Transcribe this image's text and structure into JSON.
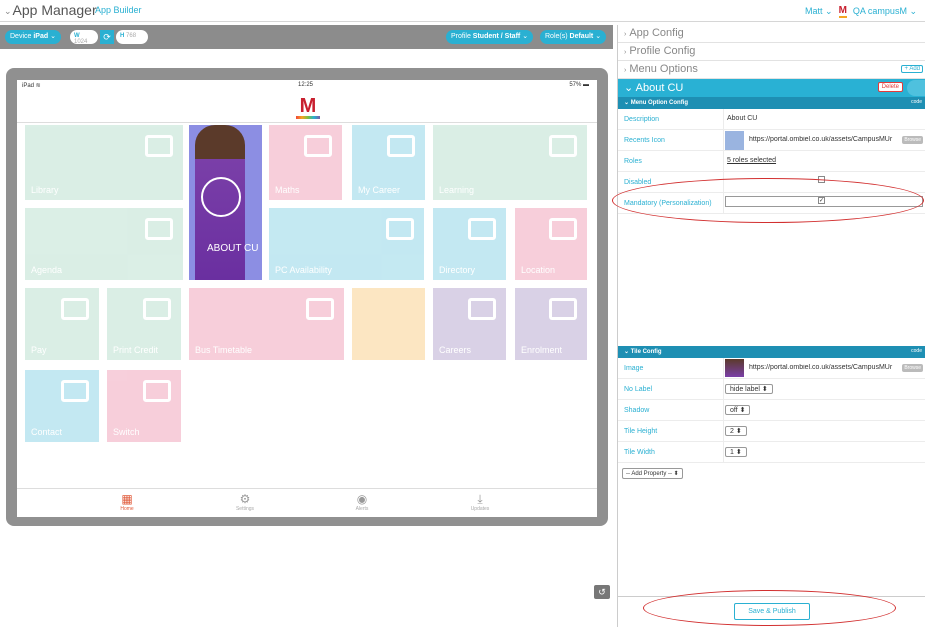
{
  "header": {
    "title": "App Manager",
    "subtitle": "App Builder",
    "user": "Matt",
    "org": "QA campusM"
  },
  "toolbar": {
    "device_label": "Device",
    "device_value": "iPad",
    "w_label": "W",
    "w_value": "1024",
    "h_label": "H",
    "h_value": "768",
    "profile_label": "Profile",
    "profile_value": "Student / Staff",
    "roles_label": "Role(s)",
    "roles_value": "Default"
  },
  "ipad": {
    "carrier": "iPad",
    "time": "12:25",
    "battery": "57%",
    "logo": "M",
    "tiles": [
      "Library",
      "Maths",
      "My Career",
      "Learning",
      "Agenda",
      "About CU",
      "PC Availability",
      "Directory",
      "Location",
      "Pay",
      "Print Credit",
      "Bus Timetable",
      "Careers",
      "Enrolment",
      "Contact",
      "Switch"
    ],
    "about_tile": "ABOUT CU",
    "tabs": [
      "Home",
      "Settings",
      "Alerts",
      "Updates"
    ]
  },
  "panel": {
    "sections": [
      "App Config",
      "Profile Config",
      "Menu Options"
    ],
    "add_label": "+ Add",
    "about_title": "About CU",
    "delete_label": "Delete",
    "menu_option_config": "Menu Option Config",
    "code_label": "code",
    "rows": {
      "description_k": "Description",
      "description_v": "About CU",
      "recents_k": "Recents Icon",
      "recents_url": "https://portal.ombiel.co.uk/assets/CampusMUr",
      "roles_k": "Roles",
      "roles_v": "5 roles selected",
      "disabled_k": "Disabled",
      "mandatory_k": "Mandatory (Personalization)"
    },
    "browse": "Browse",
    "tile_config": "Tile Config",
    "tile_rows": {
      "image_k": "Image",
      "image_url": "https://portal.ombiel.co.uk/assets/CampusMUr",
      "nolabel_k": "No Label",
      "nolabel_v": "hide label",
      "shadow_k": "Shadow",
      "shadow_v": "off",
      "height_k": "Tile Height",
      "height_v": "2",
      "width_k": "Tile Width",
      "width_v": "1"
    },
    "add_property": "-- Add Property --",
    "save": "Save & Publish"
  },
  "colors": {
    "accent": "#29b1d4",
    "brand": "#c8202f",
    "highlight": "#d23030"
  }
}
